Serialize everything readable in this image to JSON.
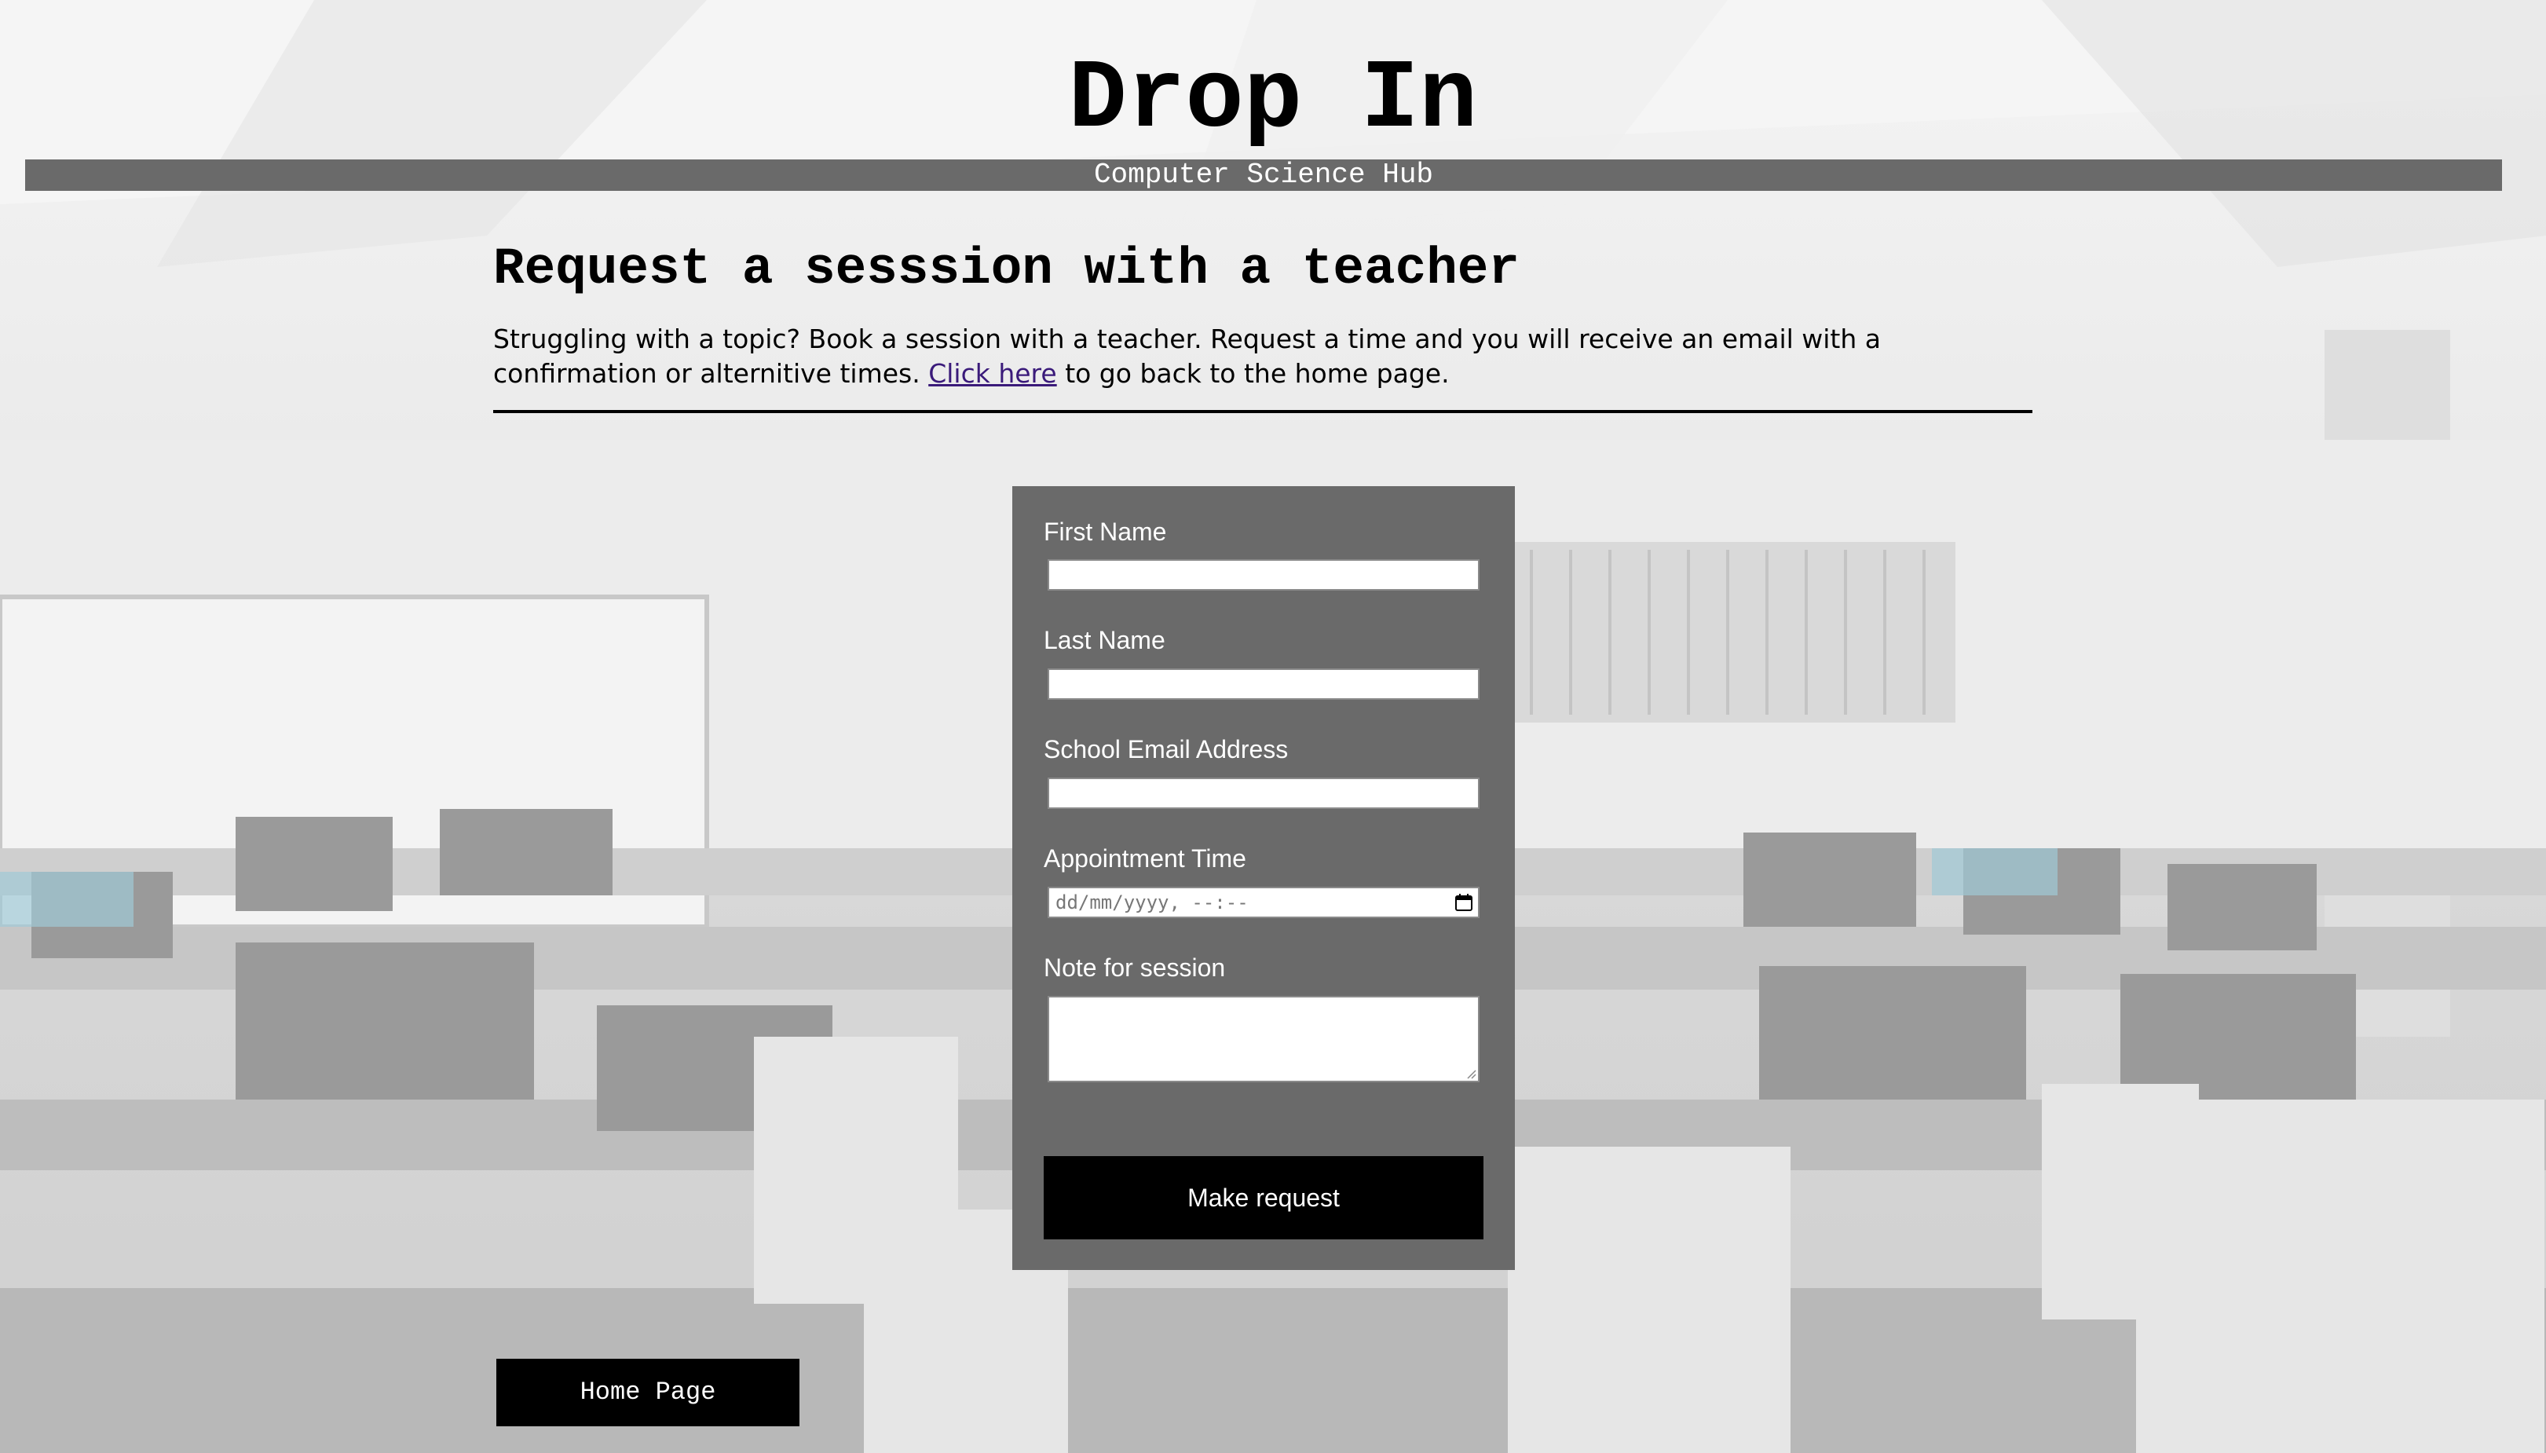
{
  "header": {
    "title": "Drop In",
    "subtitle": "Computer Science Hub"
  },
  "intro": {
    "heading": "Request a sesssion with a teacher",
    "text_before_link": "Struggling with a topic? Book a session with a teacher. Request a time and you will receive an email with a confirmation or alternitive times. ",
    "link_text": "Click here",
    "text_after_link": " to go back to the home page."
  },
  "form": {
    "first_name_label": "First Name",
    "first_name_value": "",
    "last_name_label": "Last Name",
    "last_name_value": "",
    "email_label": "School Email Address",
    "email_value": "",
    "appointment_label": "Appointment Time",
    "appointment_placeholder": "dd/mm/yyyy, --:--",
    "note_label": "Note for session",
    "note_value": "",
    "submit_label": "Make request"
  },
  "footer": {
    "home_button_label": "Home Page"
  },
  "background": {
    "description_icon": "classroom-photo"
  },
  "colors": {
    "panel": "#6a6a6a",
    "button": "#000000",
    "link": "#3a1a7a"
  }
}
